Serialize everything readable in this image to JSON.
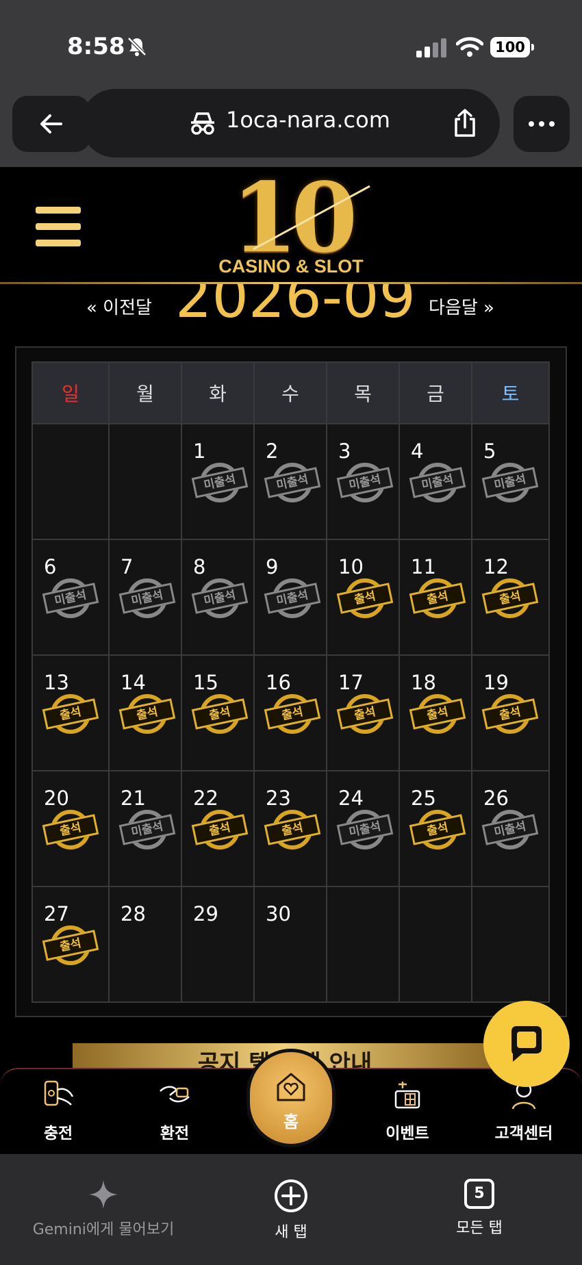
{
  "status_bar": {
    "time": "8:58",
    "battery": "100"
  },
  "browser": {
    "url": "1oca-nara.com"
  },
  "site": {
    "logo_number": "10",
    "logo_subtitle": "CASINO & SLOT"
  },
  "calendar": {
    "prev_label": "« 이전달",
    "month": "2026-09",
    "next_label": "다음달 »",
    "weekdays": [
      "일",
      "월",
      "화",
      "수",
      "목",
      "금",
      "토"
    ],
    "stamp_present": "출석",
    "stamp_absent": "미출석",
    "weeks": [
      [
        null,
        null,
        {
          "day": "1",
          "status": "absent"
        },
        {
          "day": "2",
          "status": "absent"
        },
        {
          "day": "3",
          "status": "absent"
        },
        {
          "day": "4",
          "status": "absent"
        },
        {
          "day": "5",
          "status": "absent"
        }
      ],
      [
        {
          "day": "6",
          "status": "absent"
        },
        {
          "day": "7",
          "status": "absent"
        },
        {
          "day": "8",
          "status": "absent"
        },
        {
          "day": "9",
          "status": "absent"
        },
        {
          "day": "10",
          "status": "present"
        },
        {
          "day": "11",
          "status": "present"
        },
        {
          "day": "12",
          "status": "present"
        }
      ],
      [
        {
          "day": "13",
          "status": "present"
        },
        {
          "day": "14",
          "status": "present"
        },
        {
          "day": "15",
          "status": "present"
        },
        {
          "day": "16",
          "status": "present"
        },
        {
          "day": "17",
          "status": "present"
        },
        {
          "day": "18",
          "status": "present"
        },
        {
          "day": "19",
          "status": "present"
        }
      ],
      [
        {
          "day": "20",
          "status": "present"
        },
        {
          "day": "21",
          "status": "absent"
        },
        {
          "day": "22",
          "status": "present"
        },
        {
          "day": "23",
          "status": "present"
        },
        {
          "day": "24",
          "status": "absent"
        },
        {
          "day": "25",
          "status": "present"
        },
        {
          "day": "26",
          "status": "absent"
        }
      ],
      [
        {
          "day": "27",
          "status": "present"
        },
        {
          "day": "28",
          "status": ""
        },
        {
          "day": "29",
          "status": ""
        },
        {
          "day": "30",
          "status": ""
        },
        null,
        null,
        null
      ]
    ]
  },
  "banner_text": "공지 텔레 캡 안내",
  "bottom_nav": {
    "charge": "충전",
    "exchange": "환전",
    "home": "홈",
    "event": "이벤트",
    "support": "고객센터"
  },
  "browser_toolbar": {
    "gemini": "Gemini에게 물어보기",
    "new_tab": "새 탭",
    "all_tabs": "모든 탭",
    "tab_count": "5"
  },
  "colors": {
    "accent_gold": "#f2c14e",
    "sunday_red": "#e53232",
    "saturday_blue": "#7ac2ff"
  }
}
